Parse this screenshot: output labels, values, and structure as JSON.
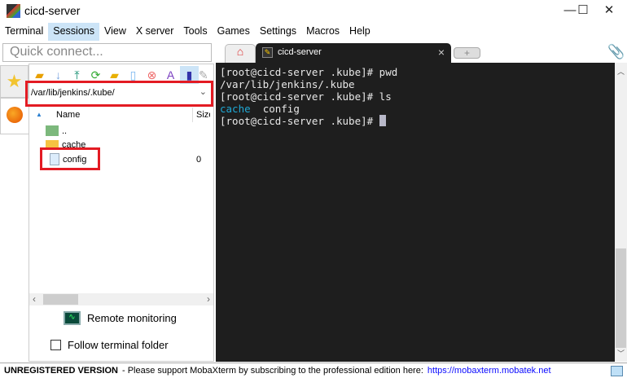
{
  "window": {
    "title": "cicd-server",
    "minimize": "—",
    "maximize": "☐",
    "close": "✕"
  },
  "menu": [
    "Terminal",
    "Sessions",
    "View",
    "X server",
    "Tools",
    "Games",
    "Settings",
    "Macros",
    "Help"
  ],
  "quick_connect": {
    "placeholder": "Quick connect..."
  },
  "tabs": [
    {
      "label": "cicd-server",
      "close": "×"
    }
  ],
  "sidebar": {
    "path": "/var/lib/jenkins/.kube/",
    "columns": {
      "name": "Name",
      "size": "Size"
    },
    "files": [
      {
        "name": "..",
        "size": ""
      },
      {
        "name": "cache",
        "size": ""
      },
      {
        "name": "config",
        "size": "0"
      }
    ],
    "remote_monitoring": "Remote monitoring",
    "follow_terminal_folder": "Follow terminal folder"
  },
  "terminal": {
    "lines": [
      "[root@cicd-server .kube]# pwd",
      "/var/lib/jenkins/.kube",
      "[root@cicd-server .kube]# ls"
    ],
    "ls_dir": "cache",
    "ls_file": "  config",
    "prompt": "[root@cicd-server .kube]# "
  },
  "status": {
    "label": "UNREGISTERED VERSION",
    "message": "-  Please support MobaXterm by subscribing to the professional edition here:",
    "link": "https://mobaxterm.mobatek.net"
  },
  "colors": {
    "highlight": "#e31b23",
    "terminal_bg": "#1e1e1e",
    "dir": "#1fa9d6",
    "link": "#0a0aff"
  }
}
